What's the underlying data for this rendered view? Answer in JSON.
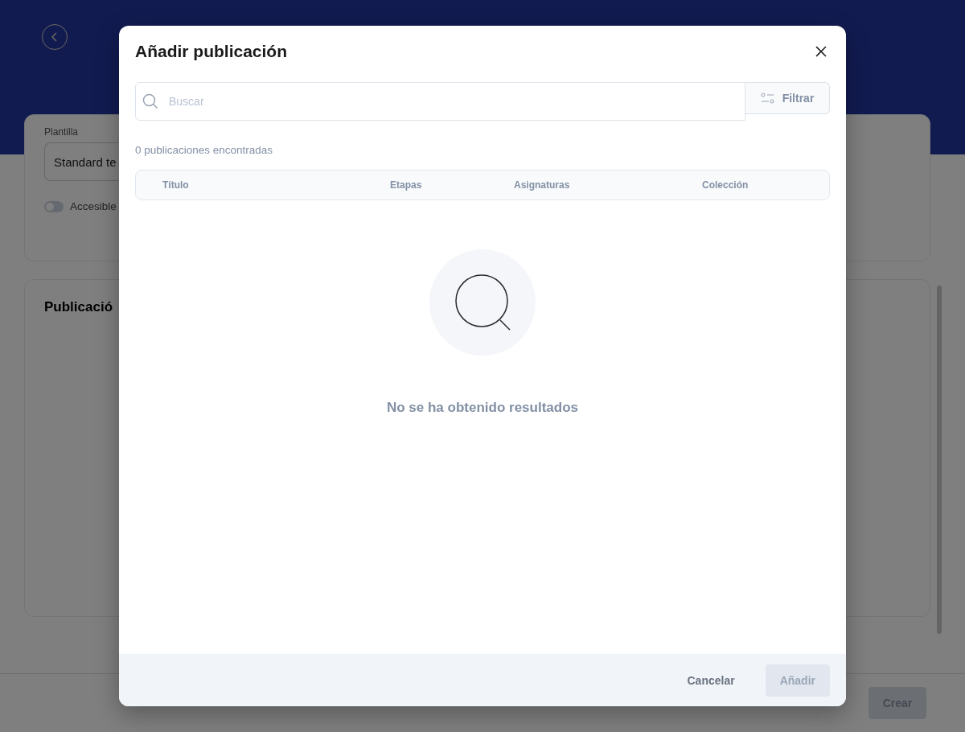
{
  "page": {
    "template_label": "Plantilla",
    "template_value": "Standard te",
    "accessible_toggle": {
      "label": "Accesible",
      "on": false
    },
    "publications_title": "Publicació",
    "create_button": {
      "label": "Crear",
      "disabled": true
    }
  },
  "dialog": {
    "title": "Añadir publicación",
    "search": {
      "placeholder": "Buscar"
    },
    "filter_button": "Filtrar",
    "result_count": "0 publicaciones encontradas",
    "table": {
      "columns": [
        "Título",
        "Etapas",
        "Asignaturas",
        "Colección"
      ]
    },
    "empty_message": "No se ha obtenido resultados",
    "buttons": [
      {
        "label": "Cancelar",
        "kind": "secondary",
        "disabled": false
      },
      {
        "label": "Añadir",
        "kind": "primary",
        "disabled": true
      }
    ]
  }
}
